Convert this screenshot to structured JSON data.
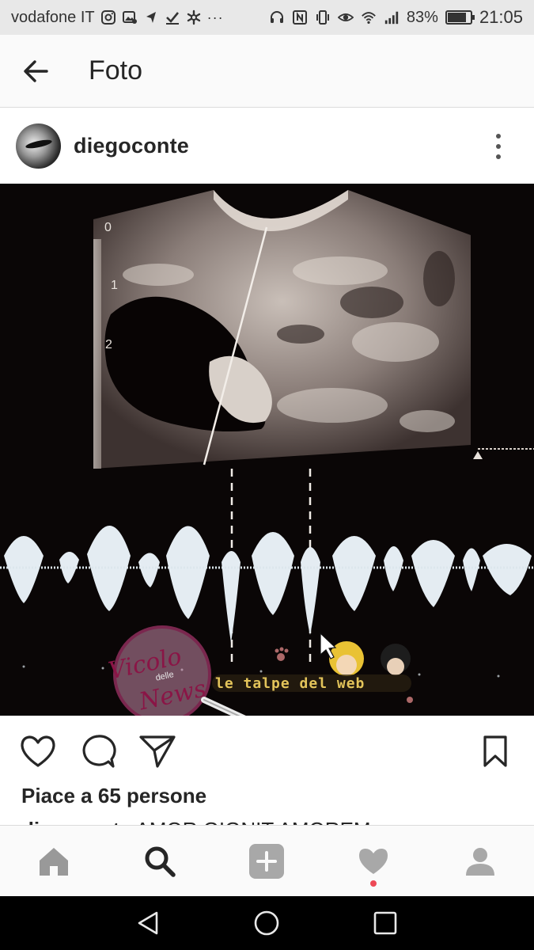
{
  "status_bar": {
    "carrier": "vodafone IT",
    "battery_percent": "83%",
    "battery_level": 0.83,
    "time": "21:05",
    "more_indicator": "···",
    "left_icons": [
      "instagram-icon",
      "gallery-icon",
      "navigation-icon",
      "check-icon",
      "asterisk-icon"
    ],
    "right_icons": [
      "headset-icon",
      "nfc-icon",
      "vibrate-icon",
      "eye-icon",
      "wifi-icon",
      "signal-icon",
      "battery-icon"
    ]
  },
  "app_bar": {
    "title": "Foto",
    "back_icon": "arrow-left-icon"
  },
  "post": {
    "username": "diegoconte",
    "more_icon": "more-vertical-icon",
    "photo": {
      "scale_marks": [
        "0",
        "1",
        "2"
      ],
      "watermark_left": [
        "Vicolo",
        "delle",
        "News"
      ],
      "watermark_right": "le talpe del web"
    },
    "likes_text": "Piace a 65 persone",
    "caption_user": "diegoconte",
    "caption_text": "AMOR GIGNIT AMOREM"
  },
  "actions": [
    "heart-icon",
    "comment-icon",
    "share-icon",
    "bookmark-icon"
  ],
  "bottom_nav": [
    "home-icon",
    "search-icon",
    "add-icon",
    "activity-icon",
    "profile-icon"
  ],
  "system_nav": [
    "back-icon",
    "home-circle-icon",
    "recents-icon"
  ],
  "colors": {
    "status_bar": "#e8e8e8",
    "notification_dot": "#ed4956",
    "photo_bg": "#0a0606",
    "text": "#262626"
  }
}
